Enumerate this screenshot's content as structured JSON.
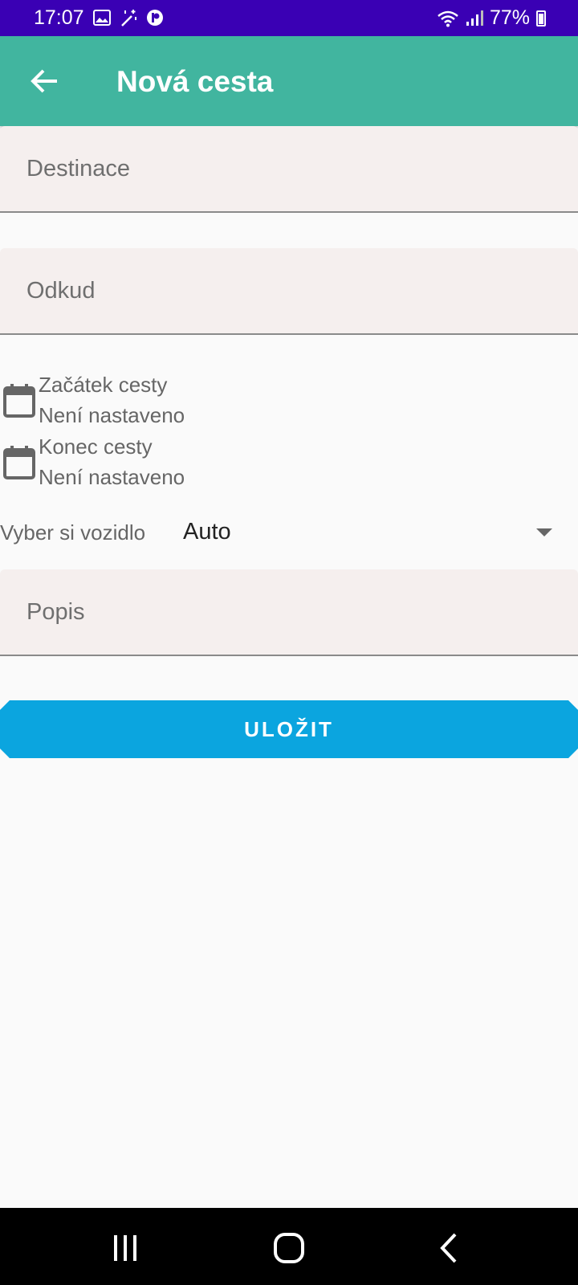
{
  "status_bar": {
    "time": "17:07",
    "battery": "77%",
    "icons": [
      "gallery-icon",
      "magic-wand-icon",
      "app-notification-icon",
      "wifi-icon",
      "signal-icon",
      "battery-icon"
    ],
    "color": "#3a00b4"
  },
  "app_bar": {
    "title": "Nová cesta",
    "back_icon": "arrow-back-icon",
    "color": "#41b59f"
  },
  "form": {
    "destination": {
      "placeholder": "Destinace",
      "value": ""
    },
    "origin": {
      "placeholder": "Odkud",
      "value": ""
    },
    "start_date": {
      "label": "Začátek cesty",
      "value": "Není nastaveno",
      "icon": "calendar-icon"
    },
    "end_date": {
      "label": "Konec cesty",
      "value": "Není nastaveno",
      "icon": "calendar-icon"
    },
    "vehicle": {
      "label": "Vyber si vozidlo",
      "selected": "Auto"
    },
    "description": {
      "placeholder": "Popis",
      "value": ""
    },
    "save_label": "ULOŽIT",
    "save_color": "#0ba5df"
  },
  "nav_bar": {
    "icons": [
      "recent-apps-icon",
      "home-icon",
      "back-icon"
    ]
  }
}
